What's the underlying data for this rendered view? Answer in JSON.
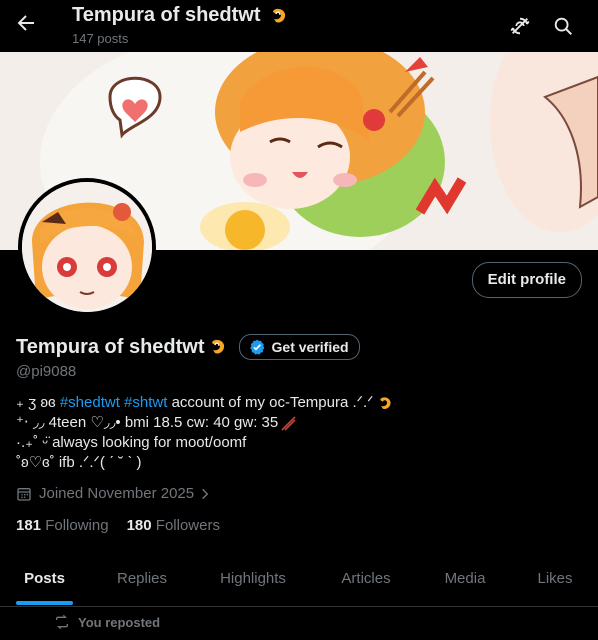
{
  "header": {
    "title": "Tempura of shedtwt",
    "post_count": "147 posts"
  },
  "profile": {
    "name": "Tempura of shedtwt",
    "get_verified_label": "Get verified",
    "handle": "@pi9088",
    "edit_profile_label": "Edit profile",
    "bio": {
      "line1_prefix": "₊ ʒ ʚɞ",
      "hashtag1": "#shedtwt",
      "hashtag2": "#shtwt",
      "line1_text": "account of my oc-Tempura .ᐟ.ᐟ",
      "line2": "⁺‧ ◞◞ 4teen ♡◞◞• bmi 18.5 cw: 40  gw: 35",
      "line3": "·.₊˚ ᵕ̈ always looking for moot/oomf",
      "line4": "˚ʚ♡ɞ˚ ifb .ᐟ.ᐟ(  ˊ ˘ ˋ )"
    },
    "joined": "Joined November 2025",
    "following_count": "181",
    "following_label": "Following",
    "followers_count": "180",
    "followers_label": "Followers"
  },
  "tabs": [
    "Posts",
    "Replies",
    "Highlights",
    "Articles",
    "Media",
    "Likes"
  ],
  "feed": {
    "repost_label": "You reposted"
  },
  "colors": {
    "accent": "#1d9bf0",
    "background": "#000000",
    "text": "#e7e9ea",
    "muted": "#71767b"
  }
}
